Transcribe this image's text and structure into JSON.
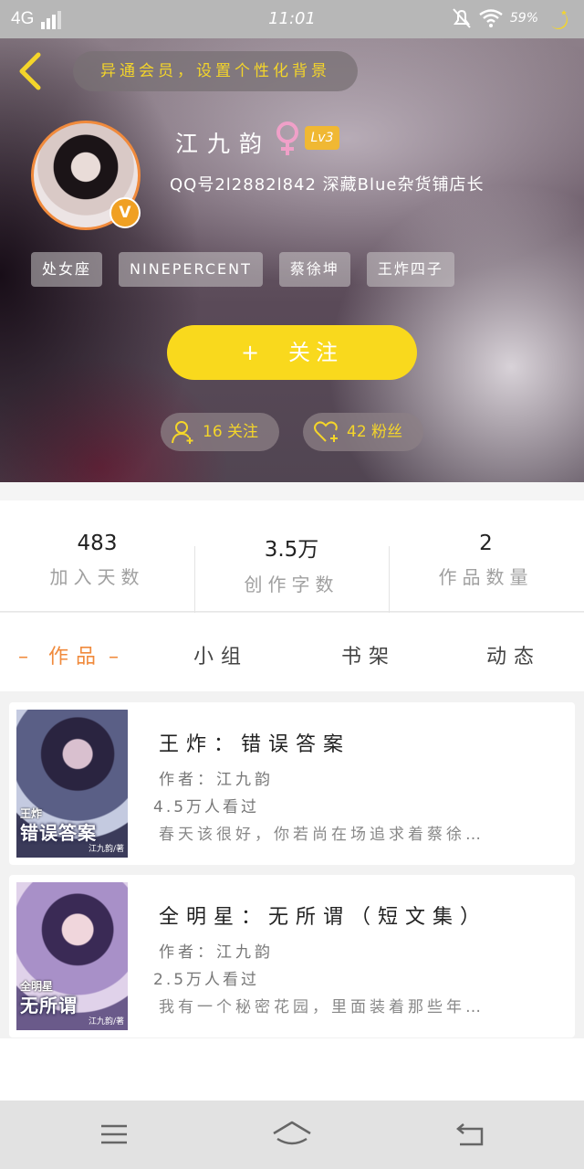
{
  "status_bar": {
    "network": "4G",
    "time": "11:01",
    "battery": "59%",
    "icons": [
      "signal-icon",
      "mute-icon",
      "wifi-icon",
      "battery-icon",
      "night-mode-icon"
    ]
  },
  "header": {
    "bg_prompt": "异通会员，设置个性化背景",
    "name": "江九韵",
    "level": "Lv3",
    "vip_badge": "V",
    "qq_line": "QQ号2l2882l842 深藏Blue杂货铺店长",
    "tags": [
      "处女座",
      "NINEPERCENT",
      "蔡徐坤",
      "王炸四子"
    ],
    "follow_button": "关注",
    "follow_plus": "+",
    "following": "16 关注",
    "fans": "42 粉丝",
    "accent": "#f9d91d"
  },
  "stats": [
    {
      "value": "483",
      "label": "加入天数"
    },
    {
      "value": "3.5万",
      "label": "创作字数"
    },
    {
      "value": "2",
      "label": "作品数量"
    }
  ],
  "tabs": [
    {
      "label": "作品",
      "active": true
    },
    {
      "label": "小组",
      "active": false
    },
    {
      "label": "书架",
      "active": false
    },
    {
      "label": "动态",
      "active": false
    }
  ],
  "tab_dash": "–",
  "works": [
    {
      "title": "王炸：错误答案",
      "author": "作者：江九韵",
      "views": "4.5万人看过",
      "desc": "春天该很好，你若尚在场追求着蔡徐…",
      "cover_title": "错误答案",
      "cover_top": "王炸",
      "cover_sub": "江九韵/著"
    },
    {
      "title": "全明星：无所谓（短文集）",
      "author": "作者：江九韵",
      "views": "2.5万人看过",
      "desc": "我有一个秘密花园，里面装着那些年…",
      "cover_title": "无所谓",
      "cover_top": "全明星",
      "cover_sub": "江九韵/著"
    }
  ],
  "nav_bar": {
    "icons": [
      "menu-icon",
      "home-icon",
      "back-icon"
    ]
  },
  "colors": {
    "active_tab": "#f08a3c",
    "gender": "#f0a0c8",
    "level_badge": "#f0b833"
  }
}
